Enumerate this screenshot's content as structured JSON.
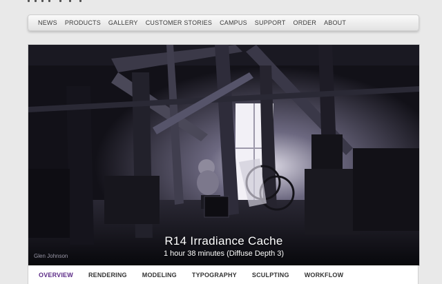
{
  "top_nav": {
    "items": [
      "NEWS",
      "PRODUCTS",
      "GALLERY",
      "CUSTOMER STORIES",
      "CAMPUS",
      "SUPPORT",
      "ORDER",
      "ABOUT"
    ]
  },
  "hero": {
    "credit": "Glen Johnson",
    "title": "R14 Irradiance Cache",
    "subtitle": "1 hour 38 minutes (Diffuse Depth 3)"
  },
  "sub_nav": {
    "items": [
      "OVERVIEW",
      "RENDERING",
      "MODELING",
      "TYPOGRAPHY",
      "SCULPTING",
      "WORKFLOW"
    ],
    "active": "OVERVIEW"
  },
  "colors": {
    "page_bg": "#e9e9e9",
    "active_tab": "#5b2a86",
    "nav_text": "#3a3a3a"
  }
}
